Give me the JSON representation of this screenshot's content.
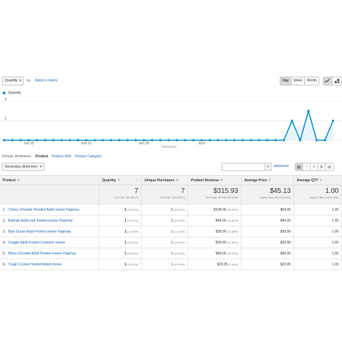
{
  "toolbar": {
    "metric": "Quantity",
    "vs": "vs.",
    "select_metric": "Select a metric",
    "periods": [
      "Day",
      "Week",
      "Month"
    ],
    "active_period": "Day"
  },
  "legend": {
    "label": "Quantity",
    "color": "#058dc7"
  },
  "chart_data": {
    "type": "area",
    "series": [
      {
        "name": "Quantity",
        "values": [
          0,
          0,
          0,
          0,
          0,
          0,
          0,
          0,
          0,
          0,
          0,
          0,
          0,
          0,
          0,
          0,
          0,
          0,
          0,
          0,
          0,
          0,
          0,
          0,
          0,
          0,
          0,
          0,
          0,
          0,
          0,
          0,
          0,
          0,
          0,
          2,
          0,
          3,
          0,
          0,
          2
        ]
      }
    ],
    "x_tick_labels": [
      "Jun 15",
      "Jun 22",
      "Jun 29",
      "Jul 6"
    ],
    "y_tick_labels": [
      "2",
      "4"
    ],
    "ylim": [
      0,
      4
    ],
    "grid": true
  },
  "dimension_bar": {
    "label": "Primary Dimension:",
    "active": "Product",
    "links": [
      "Product SKU",
      "Product Category"
    ]
  },
  "controls": {
    "secondary_dimension": "Secondary dimension",
    "advanced": "advanced"
  },
  "table": {
    "headers": [
      "Product",
      "Quantity",
      "Unique Purchases",
      "Product Revenue",
      "Average Price",
      "Average QTY"
    ],
    "totals": {
      "quantity": "7",
      "quantity_sub": "% of Total: 100.00% (7)",
      "unique": "7",
      "unique_sub": "% of Total: 100.00% (7)",
      "revenue": "$315.93",
      "revenue_sub": "% of Total: 100.00% ($315.93)",
      "avg_price": "$45.13",
      "avg_price_sub": "Avg for View: $45.13 (0.00%)",
      "avg_qty": "1.00",
      "avg_qty_sub": "Avg for View: 1.00 (0.00%)"
    },
    "rows": [
      {
        "n": "1.",
        "product": "Cherry Cheetah Hooded Adult onesie Pajamas",
        "qty": "2",
        "qty_pct": "(28.57%)",
        "unique": "2",
        "unique_pct": "(28.57%)",
        "revenue": "$108.00",
        "revenue_pct": "(34.19%)",
        "price": "$54.00",
        "avgqty": "1.00"
      },
      {
        "n": "2.",
        "product": "Batman Adult size Footed onesie Pajamas",
        "qty": "1",
        "qty_pct": "(14.29%)",
        "unique": "1",
        "unique_pct": "(14.29%)",
        "revenue": "$49.00",
        "revenue_pct": "(15.51%)",
        "price": "$49.00",
        "avgqty": "1.00"
      },
      {
        "n": "3.",
        "product": "Blue Ducks Adult Footed onesie Pajamas",
        "qty": "1",
        "qty_pct": "(14.29%)",
        "unique": "1",
        "unique_pct": "(14.29%)",
        "revenue": "$39.99",
        "revenue_pct": "(12.66%)",
        "price": "$39.99",
        "avgqty": "1.00"
      },
      {
        "n": "4.",
        "product": "Doggie Adult Footed Costume onesie",
        "qty": "1",
        "qty_pct": "(14.29%)",
        "unique": "1",
        "unique_pct": "(14.29%)",
        "revenue": "$39.99",
        "revenue_pct": "(12.66%)",
        "price": "$39.99",
        "avgqty": "1.00"
      },
      {
        "n": "5.",
        "product": "Moca Cheetah Adult Footed onesie Pajamas",
        "qty": "1",
        "qty_pct": "(14.29%)",
        "unique": "1",
        "unique_pct": "(14.29%)",
        "revenue": "$49.00",
        "revenue_pct": "(15.51%)",
        "price": "$49.00",
        "avgqty": "1.00"
      },
      {
        "n": "6.",
        "product": "Tough Cookie Hooded Adult onesie",
        "qty": "1",
        "qty_pct": "(14.29%)",
        "unique": "1",
        "unique_pct": "(14.29%)",
        "revenue": "$29.95",
        "revenue_pct": "(9.48%)",
        "price": "$29.95",
        "avgqty": "1.00"
      }
    ]
  }
}
